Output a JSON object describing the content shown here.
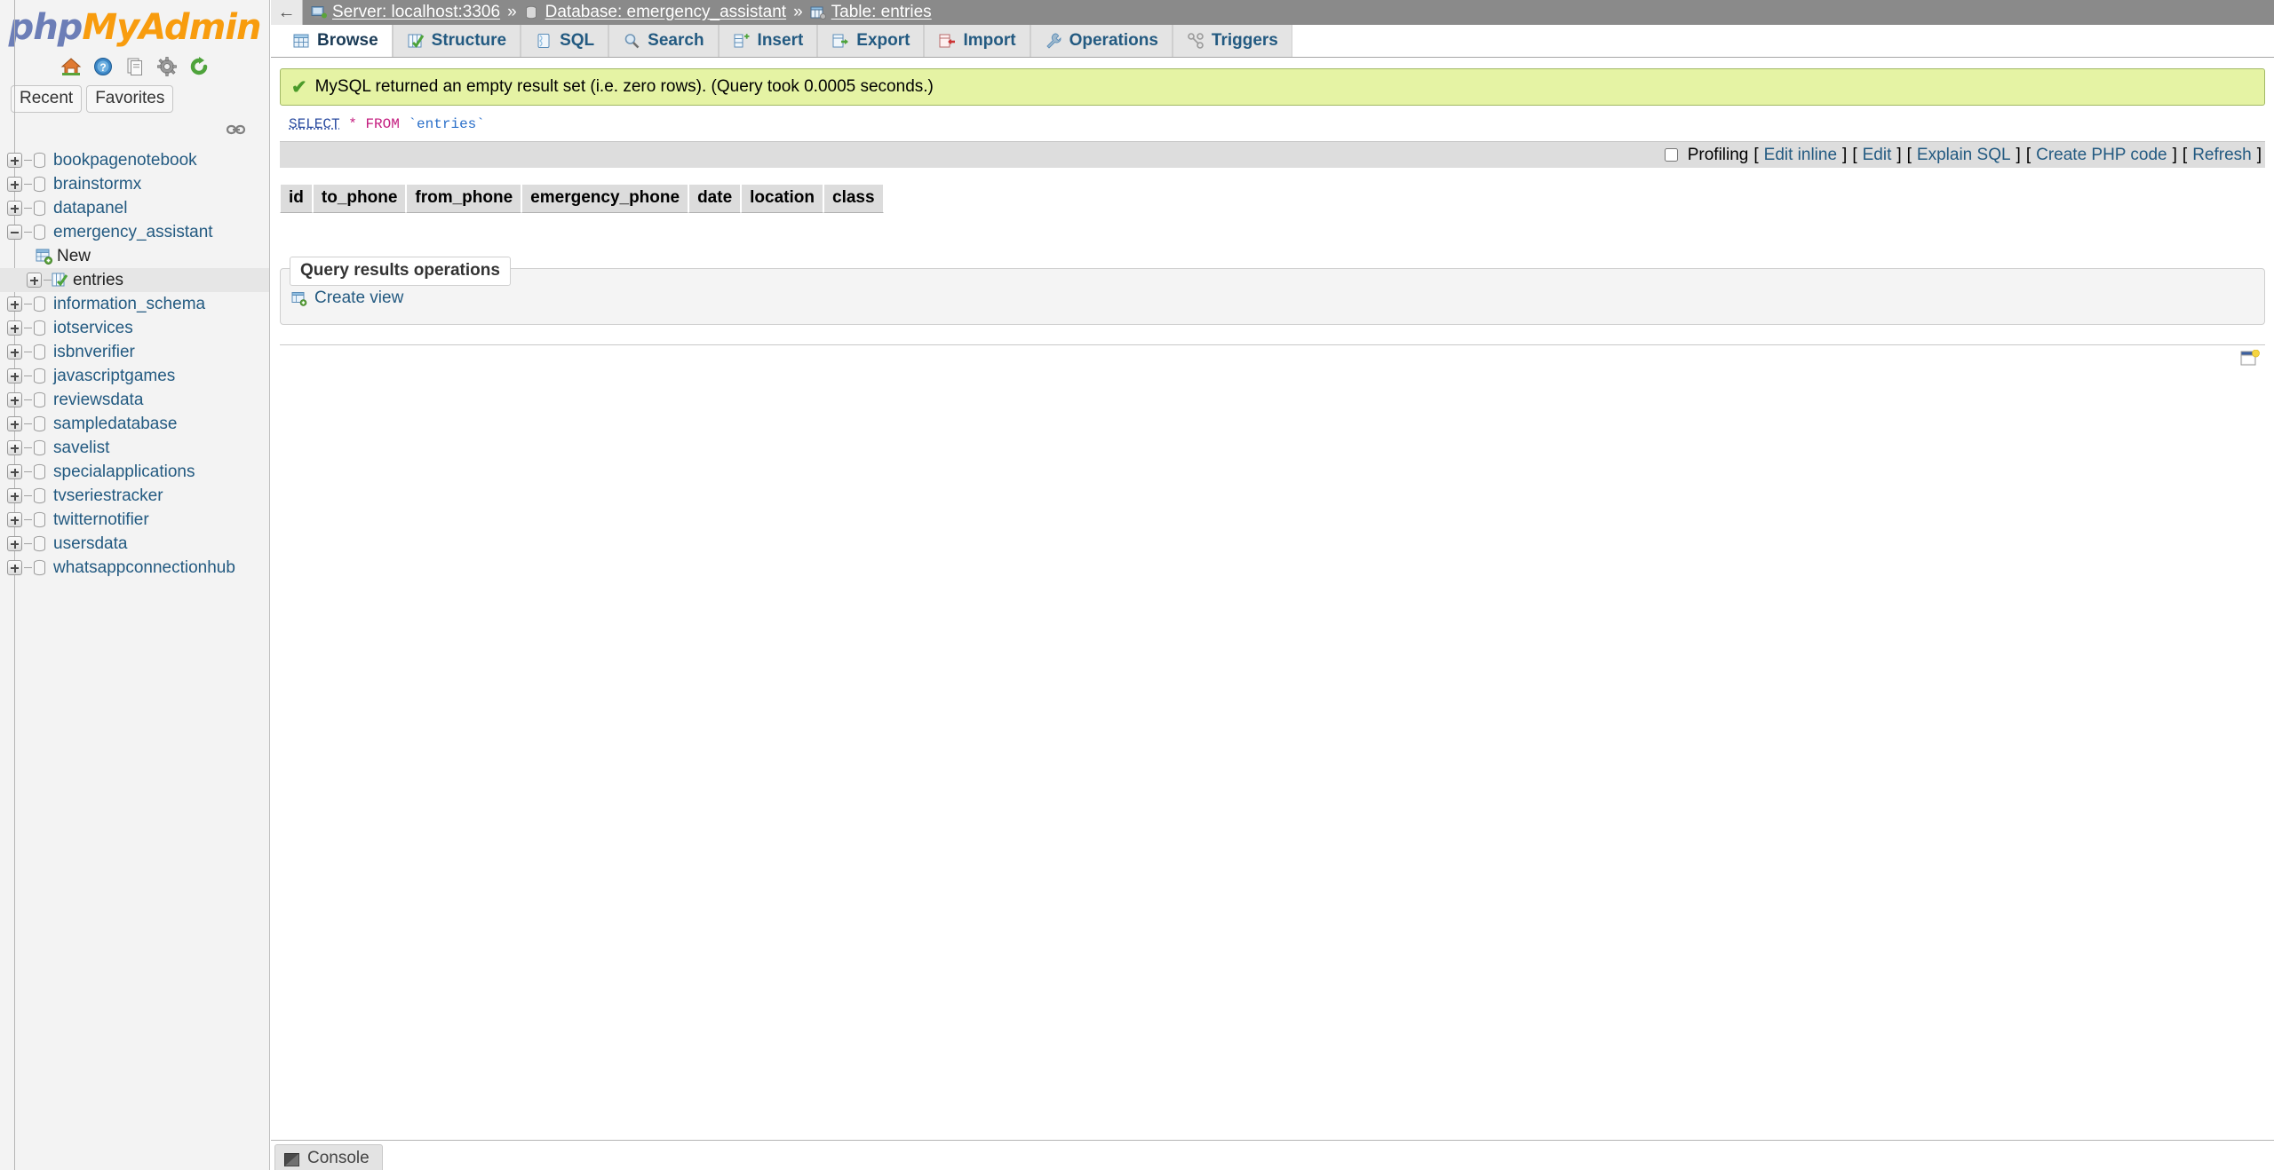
{
  "app": {
    "logo_php": "php",
    "logo_my": "My",
    "logo_admin": "Admin"
  },
  "sidebar": {
    "quick_icons": [
      {
        "name": "home-icon",
        "label": "Home"
      },
      {
        "name": "help-icon",
        "label": "Help"
      },
      {
        "name": "docs-icon",
        "label": "Documentation"
      },
      {
        "name": "settings-icon",
        "label": "Settings"
      },
      {
        "name": "reload-icon",
        "label": "Reload"
      }
    ],
    "recent_label": "Recent",
    "favorites_label": "Favorites",
    "link_icon": "link-icon",
    "databases": [
      {
        "label": "bookpagenotebook",
        "expanded": false,
        "selected": false
      },
      {
        "label": "brainstormx",
        "expanded": false,
        "selected": false
      },
      {
        "label": "datapanel",
        "expanded": false,
        "selected": false
      },
      {
        "label": "emergency_assistant",
        "expanded": true,
        "selected": false
      },
      {
        "label": "information_schema",
        "expanded": false,
        "selected": false
      },
      {
        "label": "iotservices",
        "expanded": false,
        "selected": false
      },
      {
        "label": "isbnverifier",
        "expanded": false,
        "selected": false
      },
      {
        "label": "javascriptgames",
        "expanded": false,
        "selected": false
      },
      {
        "label": "reviewsdata",
        "expanded": false,
        "selected": false
      },
      {
        "label": "sampledatabase",
        "expanded": false,
        "selected": false
      },
      {
        "label": "savelist",
        "expanded": false,
        "selected": false
      },
      {
        "label": "specialapplications",
        "expanded": false,
        "selected": false
      },
      {
        "label": "tvseriestracker",
        "expanded": false,
        "selected": false
      },
      {
        "label": "twitternotifier",
        "expanded": false,
        "selected": false
      },
      {
        "label": "usersdata",
        "expanded": false,
        "selected": false
      },
      {
        "label": "whatsappconnectionhub",
        "expanded": false,
        "selected": false
      }
    ],
    "emergency_children": [
      {
        "label": "New",
        "type": "new",
        "selected": false
      },
      {
        "label": "entries",
        "type": "table",
        "selected": true
      }
    ]
  },
  "topbar": {
    "collapse_icon": "←",
    "breadcrumb": [
      {
        "icon": "server-icon",
        "text": "Server: localhost:3306"
      },
      {
        "icon": "database-icon",
        "text": "Database: emergency_assistant"
      },
      {
        "icon": "table-icon",
        "text": "Table: entries"
      }
    ],
    "separator": "»"
  },
  "tabs": [
    {
      "label": "Browse",
      "icon": "browse-icon",
      "active": true
    },
    {
      "label": "Structure",
      "icon": "structure-icon",
      "active": false
    },
    {
      "label": "SQL",
      "icon": "sql-icon",
      "active": false
    },
    {
      "label": "Search",
      "icon": "search-icon",
      "active": false
    },
    {
      "label": "Insert",
      "icon": "insert-icon",
      "active": false
    },
    {
      "label": "Export",
      "icon": "export-icon",
      "active": false
    },
    {
      "label": "Import",
      "icon": "import-icon",
      "active": false
    },
    {
      "label": "Operations",
      "icon": "operations-icon",
      "active": false
    },
    {
      "label": "Triggers",
      "icon": "triggers-icon",
      "active": false
    }
  ],
  "result": {
    "message": "MySQL returned an empty result set (i.e. zero rows). (Query took 0.0005 seconds.)",
    "check_glyph": "✔",
    "background": "#e5f3a4",
    "border": "#a2b965"
  },
  "sql": {
    "keyword_select": "SELECT",
    "star": "*",
    "keyword_from": "FROM",
    "table": "`entries`"
  },
  "profiling": {
    "label": "Profiling",
    "checked": false,
    "links": [
      "Edit inline",
      "Edit",
      "Explain SQL",
      "Create PHP code",
      "Refresh"
    ],
    "bracket_open": "[",
    "bracket_close": "]"
  },
  "results": {
    "columns": [
      "id",
      "to_phone",
      "from_phone",
      "emergency_phone",
      "date",
      "location",
      "class"
    ],
    "rows": []
  },
  "query_ops": {
    "legend": "Query results operations",
    "create_view_label": "Create view",
    "create_view_icon": "create-view-icon"
  },
  "corner": {
    "icon": "window-bookmark-icon"
  },
  "console": {
    "label": "Console",
    "icon": "console-icon"
  }
}
